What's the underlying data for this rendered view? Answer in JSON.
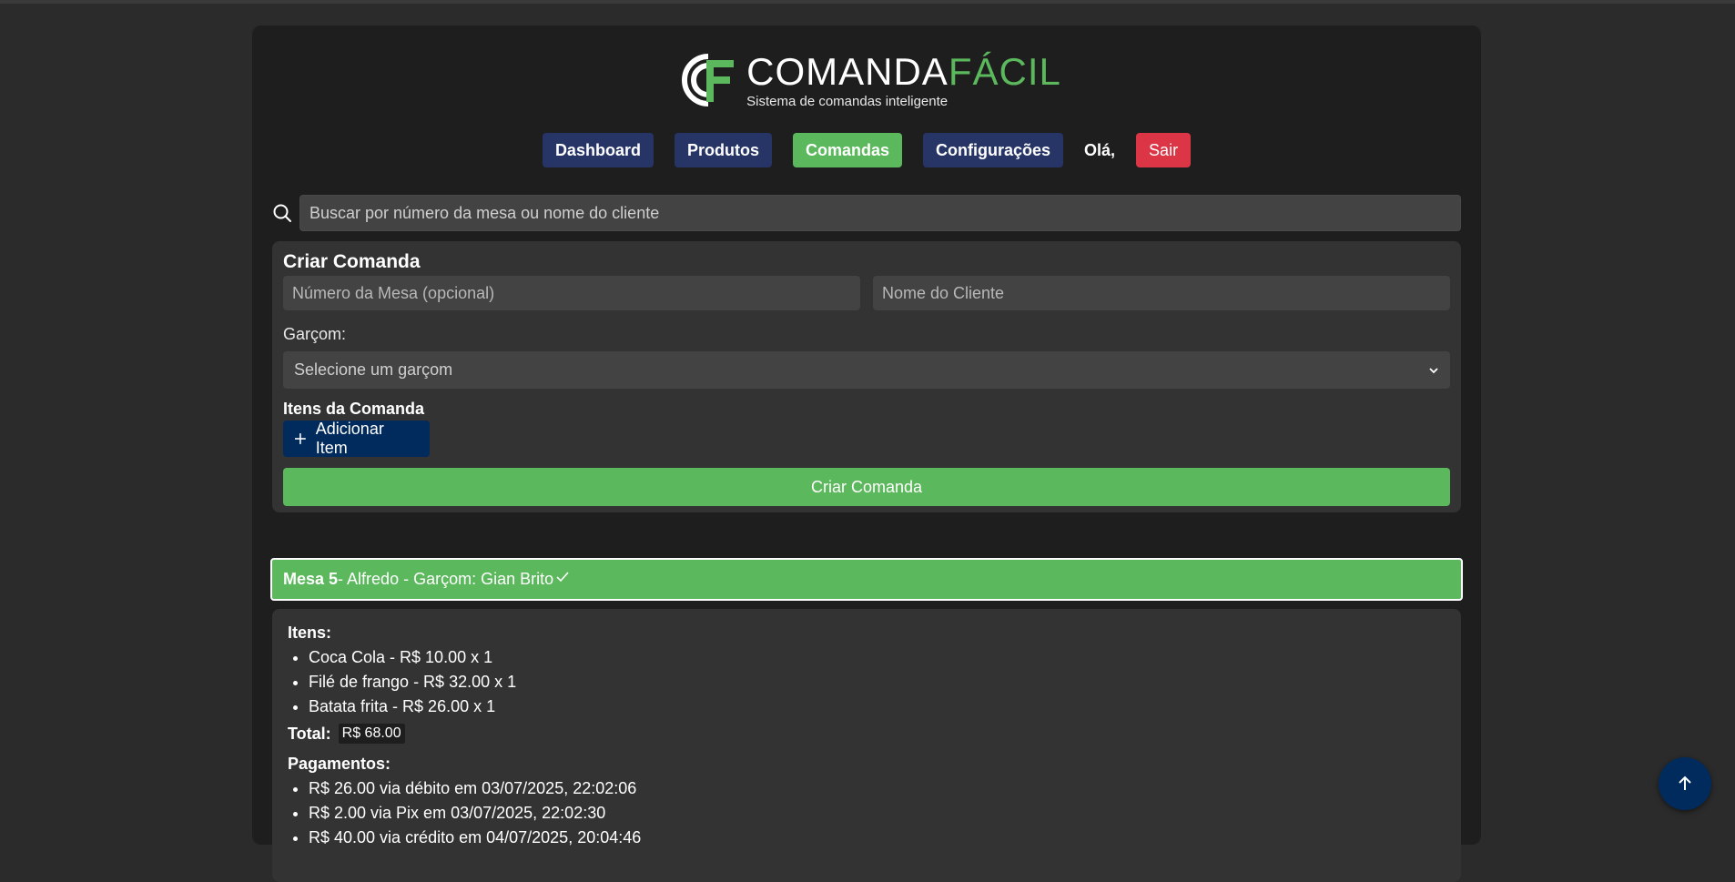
{
  "brand": {
    "name_main": "COMANDA",
    "name_accent": "FÁCIL",
    "tagline": "Sistema de comandas inteligente",
    "accent_color": "#5cb85c"
  },
  "nav": {
    "items": [
      {
        "label": "Dashboard",
        "active": false
      },
      {
        "label": "Produtos",
        "active": false
      },
      {
        "label": "Comandas",
        "active": true
      },
      {
        "label": "Configurações",
        "active": false
      }
    ],
    "greeting": "Olá,",
    "logout_label": "Sair"
  },
  "search": {
    "placeholder": "Buscar por número da mesa ou nome do cliente",
    "icon": "search-icon"
  },
  "create": {
    "title": "Criar Comanda",
    "table_placeholder": "Número da Mesa (opcional)",
    "client_placeholder": "Nome do Cliente",
    "waiter_label": "Garçom:",
    "waiter_select_value": "Selecione um garçom",
    "items_label": "Itens da Comanda",
    "add_item_label": "Adicionar Item",
    "submit_label": "Criar Comanda"
  },
  "order": {
    "table": "Mesa 5",
    "rest": " - Alfredo - Garçom: Gian Brito",
    "items_title": "Itens:",
    "items": [
      "Coca Cola - R$ 10.00 x 1",
      "Filé de frango - R$ 32.00 x 1",
      "Batata frita - R$ 26.00 x 1"
    ],
    "total_label": "Total:",
    "total_value": "R$ 68.00",
    "payments_title": "Pagamentos:",
    "payments": [
      "R$ 26.00 via débito em 03/07/2025, 22:02:06",
      "R$ 2.00 via Pix em 03/07/2025, 22:02:30",
      "R$ 40.00 via crédito em 04/07/2025, 20:04:46"
    ]
  }
}
